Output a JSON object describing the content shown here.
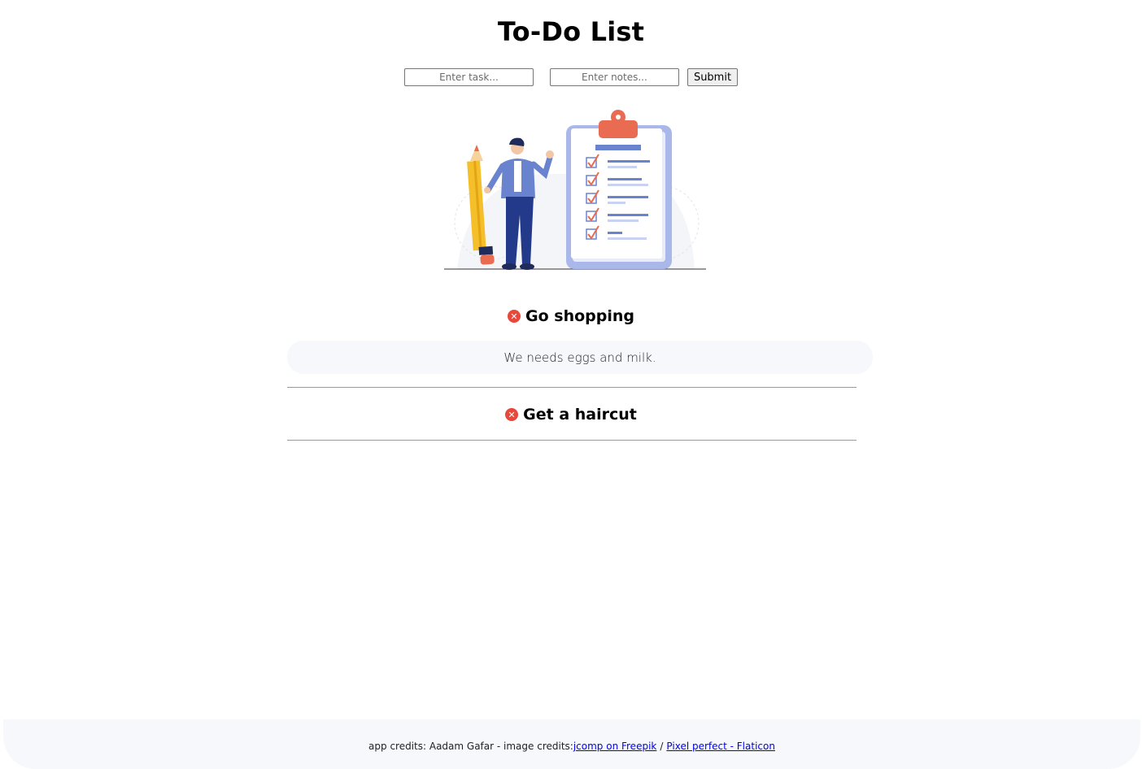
{
  "header": {
    "title": "To-Do List"
  },
  "form": {
    "task_placeholder": "Enter task...",
    "notes_placeholder": "Enter notes...",
    "submit_label": "Submit"
  },
  "todos": [
    {
      "title": "Go shopping",
      "notes": "We needs eggs and milk.",
      "delete_icon": "close-circle-icon"
    },
    {
      "title": "Get a haircut",
      "notes": "",
      "delete_icon": "close-circle-icon"
    }
  ],
  "footer": {
    "app_credits": "app credits: Aadam Gafar - image credits: ",
    "link1": "jcomp on Freepik",
    "separator": "/",
    "link2": "Pixel perfect - Flaticon"
  },
  "colors": {
    "accent_red": "#e8473b",
    "clipboard": "#a9b8e8",
    "pencil": "#f5bf2a",
    "note_bg": "#f7f8fc"
  }
}
